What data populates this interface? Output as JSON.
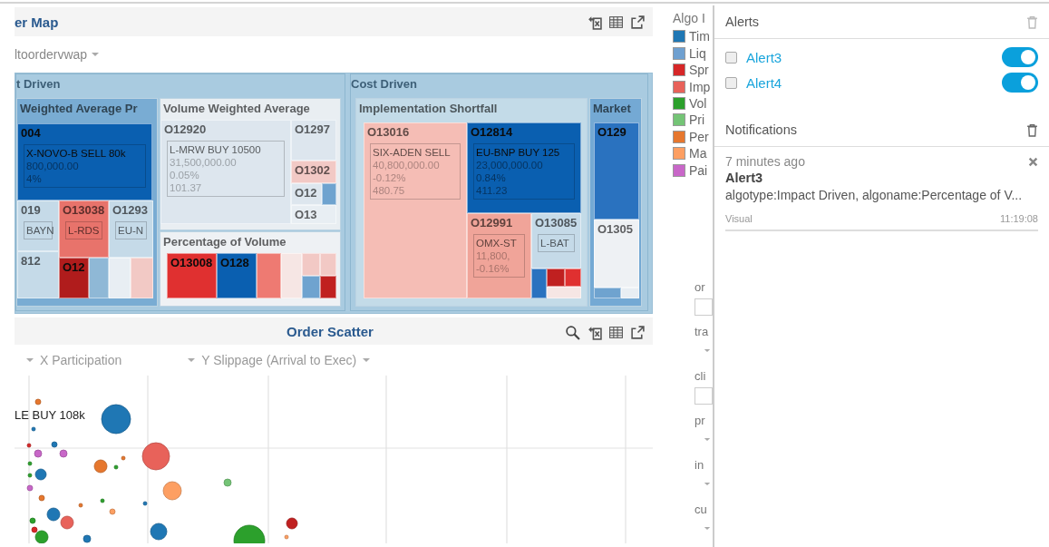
{
  "map_panel": {
    "title": "er Map",
    "filter": "ltoordervwap",
    "groups": [
      {
        "title": "t Driven",
        "subgroups": [
          {
            "title": "Weighted Average Pr",
            "color": "#79acd3",
            "tiles": [
              {
                "label": "004",
                "lines": [
                  "X-NOVO-B SELL 80k",
                  "800,000.00",
                  "4%"
                ],
                "color": "#0a5fb0"
              },
              {
                "label": "019",
                "lines": [
                  "BAYN"
                ],
                "color": "#c5dae8"
              },
              {
                "label": "O13038",
                "lines": [
                  "L-RDS"
                ],
                "color": "#e8736b"
              },
              {
                "label": "O1293",
                "lines": [
                  "EU-N"
                ],
                "color": "#c5dae8"
              },
              {
                "label": "812",
                "color": "#c5dae8"
              },
              {
                "label": "O12",
                "color": "#b01c1c"
              },
              {
                "color": "#8fb8d6"
              },
              {
                "color": "#e8eef3"
              },
              {
                "color": "#f2c9c5"
              }
            ]
          },
          {
            "title": "Volume Weighted Average",
            "color": "#e9eef2",
            "tiles": [
              {
                "label": "O12920",
                "lines": [
                  "L-MRW BUY 10500",
                  "31,500,000.00",
                  "0.05%",
                  "101.37"
                ],
                "color": "#dde6ee"
              },
              {
                "label": "O1297",
                "color": "#dde6ee"
              },
              {
                "label": "O1302",
                "color": "#f2c9c5"
              },
              {
                "label": "O12",
                "color": "#dde6ee"
              },
              {
                "color": "#6fa3cf"
              },
              {
                "label": "O13",
                "color": "#e8eef3"
              }
            ]
          },
          {
            "title": "Percentage of Volume",
            "color": "#eef1f4",
            "tiles": [
              {
                "label": "O13008",
                "color": "#e03030"
              },
              {
                "label": "O128",
                "color": "#0a5fb0"
              },
              {
                "color": "#ee7a72"
              },
              {
                "color": "#f6e6e4"
              },
              {
                "color": "#f2c9c5"
              },
              {
                "color": "#f2c9c5"
              },
              {
                "color": "#6fa3cf"
              },
              {
                "color": "#c02020"
              }
            ]
          }
        ]
      },
      {
        "title": "Cost Driven",
        "subgroups": [
          {
            "title": "Implementation Shortfall",
            "color": "#c3dbe8",
            "tiles": [
              {
                "label": "O13016",
                "lines": [
                  "SIX-ADEN SELL",
                  "40,800,000.00",
                  "-0.12%",
                  "480.75"
                ],
                "color": "#f5bdb5"
              },
              {
                "label": "O12814",
                "lines": [
                  "EU-BNP BUY 125",
                  "23,000,000.00",
                  "0.84%",
                  "411.23"
                ],
                "color": "#0a5fb0"
              },
              {
                "label": "O12991",
                "lines": [
                  "OMX-ST",
                  "11,800,",
                  "-0.16%"
                ],
                "color": "#f0a499"
              },
              {
                "label": "O13085",
                "lines": [
                  "L-BAT"
                ],
                "color": "#c5dae8"
              },
              {
                "color": "#2a72bf"
              },
              {
                "color": "#c02020"
              },
              {
                "color": "#e03030"
              },
              {
                "color": "#f6e6e4"
              }
            ]
          },
          {
            "title": "Market",
            "color": "#74a9d4",
            "tiles": [
              {
                "label": "O129",
                "color": "#2a72bf"
              },
              {
                "label": "O1305",
                "color": "#eef1f4"
              },
              {
                "color": "#6fa3cf"
              },
              {
                "color": "#e8eef3"
              }
            ]
          }
        ]
      }
    ]
  },
  "scatter_panel": {
    "title": "Order Scatter",
    "x_axis": "X Participation",
    "y_axis": "Y Slippage (Arrival to Exec)",
    "point_label": "LE BUY 108k"
  },
  "legend": {
    "title": "Algo I",
    "items": [
      {
        "label": "Tim",
        "color": "#1f77b4"
      },
      {
        "label": "Liq",
        "color": "#6fa0d0"
      },
      {
        "label": "Spr",
        "color": "#d62728"
      },
      {
        "label": "Imp",
        "color": "#e8625a"
      },
      {
        "label": "Vol",
        "color": "#2ca02c"
      },
      {
        "label": "Pri",
        "color": "#74c476"
      },
      {
        "label": "Per",
        "color": "#e6772e"
      },
      {
        "label": "Ma",
        "color": "#fd9f62"
      },
      {
        "label": "Pai",
        "color": "#c867c8"
      }
    ]
  },
  "filters": [
    {
      "label": "or",
      "kind": "field"
    },
    {
      "label": "tra",
      "kind": "dropdown"
    },
    {
      "label": "cli",
      "kind": "field"
    },
    {
      "label": "pr",
      "kind": "dropdown"
    },
    {
      "label": "in",
      "kind": "dropdown"
    },
    {
      "label": "cu",
      "kind": "dropdown"
    }
  ],
  "alerts_panel": {
    "title": "Alerts",
    "alerts": [
      {
        "name": "Alert3",
        "checked": false,
        "on": true
      },
      {
        "name": "Alert4",
        "checked": false,
        "on": true
      }
    ],
    "notifications_title": "Notifications",
    "notifications": [
      {
        "time_ago": "7 minutes ago",
        "title": "Alert3",
        "message": "algotype:Impact Driven, algoname:Percentage of V...",
        "source": "Visual",
        "time": "11:19:08"
      }
    ]
  }
}
